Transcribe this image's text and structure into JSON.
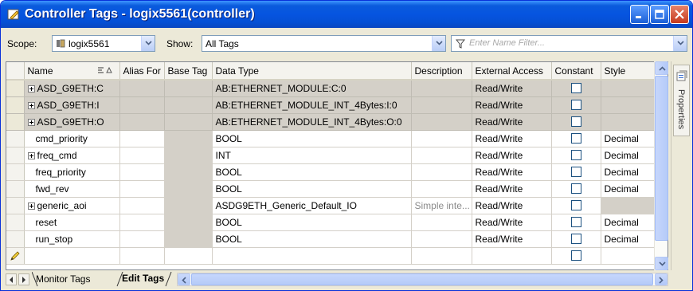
{
  "window": {
    "title": "Controller Tags - logix5561(controller)"
  },
  "toolbar": {
    "scope_label": "Scope:",
    "scope_value": "logix5561",
    "show_label": "Show:",
    "show_value": "All Tags",
    "filter_placeholder": "Enter Name Filter..."
  },
  "grid": {
    "columns": [
      "Name",
      "Alias For",
      "Base Tag",
      "Data Type",
      "Description",
      "External Access",
      "Constant",
      "Style"
    ],
    "rows": [
      {
        "name": "ASD_G9ETH:C",
        "expandable": true,
        "data_type": "AB:ETHERNET_MODULE:C:0",
        "description": "",
        "external_access": "Read/Write",
        "style": "",
        "shaded": true
      },
      {
        "name": "ASD_G9ETH:I",
        "expandable": true,
        "data_type": "AB:ETHERNET_MODULE_INT_4Bytes:I:0",
        "description": "",
        "external_access": "Read/Write",
        "style": "",
        "shaded": true
      },
      {
        "name": "ASD_G9ETH:O",
        "expandable": true,
        "data_type": "AB:ETHERNET_MODULE_INT_4Bytes:O:0",
        "description": "",
        "external_access": "Read/Write",
        "style": "",
        "shaded": true
      },
      {
        "name": "cmd_priority",
        "expandable": false,
        "data_type": "BOOL",
        "description": "",
        "external_access": "Read/Write",
        "style": "Decimal",
        "shaded": false
      },
      {
        "name": "freq_cmd",
        "expandable": true,
        "data_type": "INT",
        "description": "",
        "external_access": "Read/Write",
        "style": "Decimal",
        "shaded": false
      },
      {
        "name": "freq_priority",
        "expandable": false,
        "data_type": "BOOL",
        "description": "",
        "external_access": "Read/Write",
        "style": "Decimal",
        "shaded": false
      },
      {
        "name": "fwd_rev",
        "expandable": false,
        "data_type": "BOOL",
        "description": "",
        "external_access": "Read/Write",
        "style": "Decimal",
        "shaded": false
      },
      {
        "name": "generic_aoi",
        "expandable": true,
        "data_type": "ASDG9ETH_Generic_Default_IO",
        "description": "Simple inte...",
        "external_access": "Read/Write",
        "style": "",
        "shaded": false
      },
      {
        "name": "reset",
        "expandable": false,
        "data_type": "BOOL",
        "description": "",
        "external_access": "Read/Write",
        "style": "Decimal",
        "shaded": false
      },
      {
        "name": "run_stop",
        "expandable": false,
        "data_type": "BOOL",
        "description": "",
        "external_access": "Read/Write",
        "style": "Decimal",
        "shaded": false
      },
      {
        "name": "",
        "expandable": false,
        "data_type": "",
        "description": "",
        "external_access": "",
        "style": "",
        "shaded": false,
        "new_row": true
      }
    ]
  },
  "side_panel": {
    "properties_label": "Properties"
  },
  "bottom_tabs": {
    "monitor_label": "Monitor Tags",
    "edit_label": "Edit Tags"
  },
  "colors": {
    "titlebar": "#0654e0",
    "shaded_row": "#d4d0c8",
    "window_face": "#ece9d8"
  }
}
